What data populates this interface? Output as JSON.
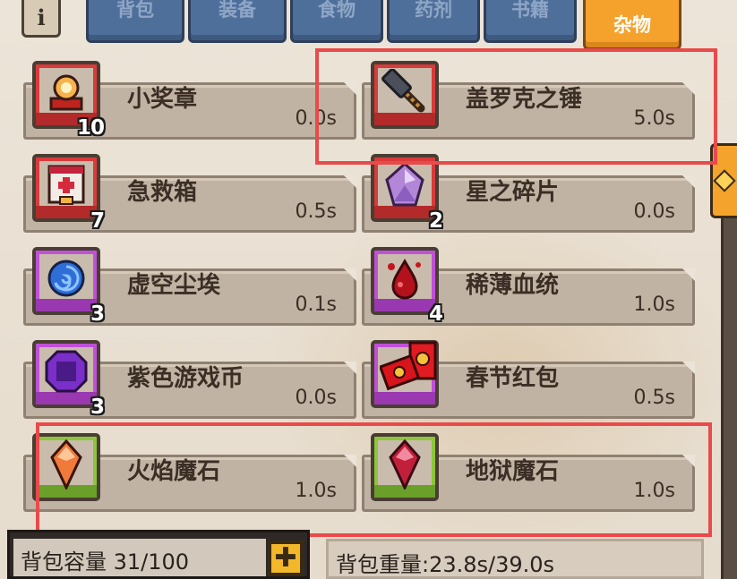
{
  "tabs": [
    {
      "label": "背包",
      "active": false
    },
    {
      "label": "装备",
      "active": false
    },
    {
      "label": "食物",
      "active": false
    },
    {
      "label": "药剂",
      "active": false
    },
    {
      "label": "书籍",
      "active": false
    },
    {
      "label": "杂物",
      "active": true
    }
  ],
  "info_button": {
    "label": "i"
  },
  "items": [
    {
      "name": "小奖章",
      "count": "10",
      "weight": "0.0s",
      "rarity_color": "#d93a3a",
      "icon": "medal-icon"
    },
    {
      "name": "盖罗克之锤",
      "count": "",
      "weight": "5.0s",
      "rarity_color": "#d93a3a",
      "icon": "hammer-icon"
    },
    {
      "name": "急救箱",
      "count": "7",
      "weight": "0.5s",
      "rarity_color": "#d93a3a",
      "icon": "first-aid-kit-icon"
    },
    {
      "name": "星之碎片",
      "count": "2",
      "weight": "0.0s",
      "rarity_color": "#d93a3a",
      "icon": "star-shard-icon"
    },
    {
      "name": "虚空尘埃",
      "count": "3",
      "weight": "0.1s",
      "rarity_color": "#c050d8",
      "icon": "void-dust-icon"
    },
    {
      "name": "稀薄血统",
      "count": "4",
      "weight": "1.0s",
      "rarity_color": "#c050d8",
      "icon": "blood-drop-icon"
    },
    {
      "name": "紫色游戏币",
      "count": "3",
      "weight": "0.0s",
      "rarity_color": "#c050d8",
      "icon": "purple-coin-icon"
    },
    {
      "name": "春节红包",
      "count": "",
      "weight": "0.5s",
      "rarity_color": "#c050d8",
      "icon": "red-envelope-icon"
    },
    {
      "name": "火焰魔石",
      "count": "",
      "weight": "1.0s",
      "rarity_color": "#8cc63a",
      "icon": "fire-gem-icon"
    },
    {
      "name": "地狱魔石",
      "count": "",
      "weight": "1.0s",
      "rarity_color": "#8cc63a",
      "icon": "hell-gem-icon"
    }
  ],
  "capacity": {
    "label": "背包容量 31/100"
  },
  "weight_total": {
    "label": "背包重量:23.8s/39.0s"
  },
  "colors": {
    "accent": "#f5a22c",
    "highlight": "#e94a4a",
    "tab_blue": "#4f6f9b"
  }
}
